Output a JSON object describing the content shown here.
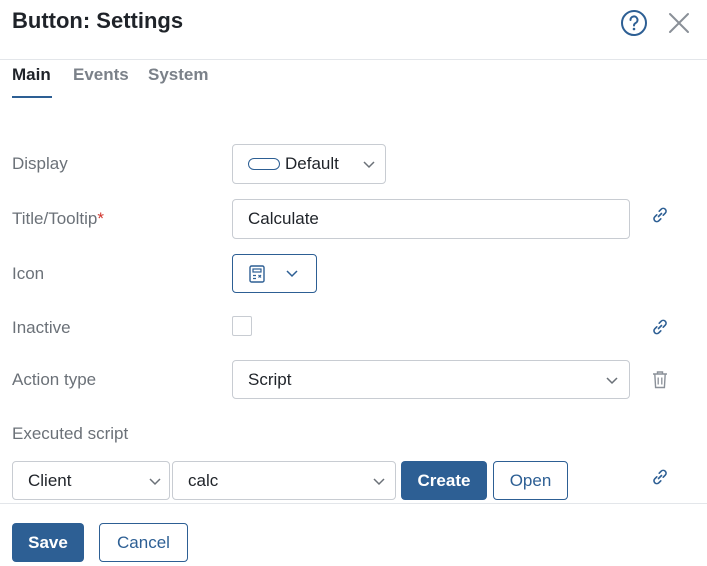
{
  "dialog": {
    "title": "Button: Settings"
  },
  "tabs": [
    {
      "label": "Main",
      "active": true
    },
    {
      "label": "Events",
      "active": false
    },
    {
      "label": "System",
      "active": false
    }
  ],
  "form": {
    "display": {
      "label": "Display",
      "value": "Default"
    },
    "title_tooltip": {
      "label": "Title/Tooltip",
      "required_mark": "*",
      "value": "Calculate"
    },
    "icon": {
      "label": "Icon",
      "value_icon": "calculator-icon"
    },
    "inactive": {
      "label": "Inactive",
      "checked": false
    },
    "action_type": {
      "label": "Action type",
      "value": "Script"
    },
    "executed_script": {
      "label": "Executed script",
      "side": "Client",
      "script": "calc",
      "create_label": "Create",
      "open_label": "Open"
    }
  },
  "footer": {
    "save_label": "Save",
    "cancel_label": "Cancel"
  },
  "colors": {
    "primary": "#2d5f94",
    "required": "#d0342c",
    "label": "#6b7178",
    "border": "#c8ccd2"
  }
}
